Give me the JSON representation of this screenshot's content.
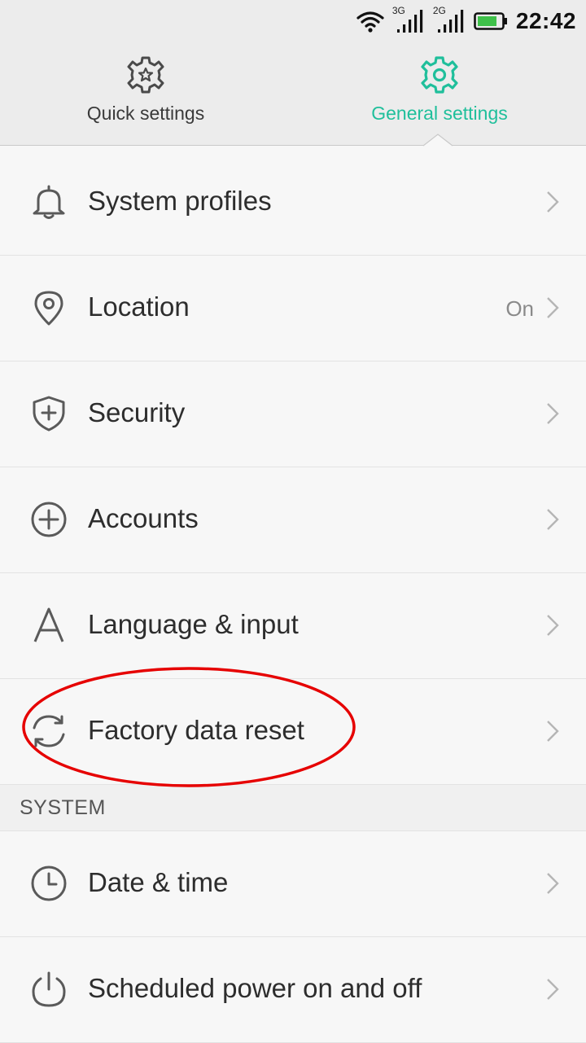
{
  "status_bar": {
    "network_3g": "3G",
    "network_2g": "2G",
    "time": "22:42",
    "battery_color": "#3fc14a"
  },
  "tabs": [
    {
      "label": "Quick settings",
      "icon": "gear-star-icon",
      "active": false
    },
    {
      "label": "General settings",
      "icon": "gear-icon",
      "active": true
    }
  ],
  "accent_color": "#1fbf9b",
  "items": [
    {
      "label": "System profiles",
      "icon": "bell-icon"
    },
    {
      "label": "Location",
      "icon": "location-pin-icon",
      "value": "On"
    },
    {
      "label": "Security",
      "icon": "shield-plus-icon"
    },
    {
      "label": "Accounts",
      "icon": "plus-circle-icon"
    },
    {
      "label": "Language & input",
      "icon": "letter-a-icon"
    },
    {
      "label": "Factory data reset",
      "icon": "refresh-icon"
    }
  ],
  "section_system": {
    "title": "SYSTEM"
  },
  "system_items": [
    {
      "label": "Date & time",
      "icon": "clock-icon"
    },
    {
      "label": "Scheduled power on and off",
      "icon": "power-icon"
    }
  ],
  "annotation": {
    "shape": "ellipse",
    "color": "#e60000",
    "target": "Factory data reset"
  }
}
